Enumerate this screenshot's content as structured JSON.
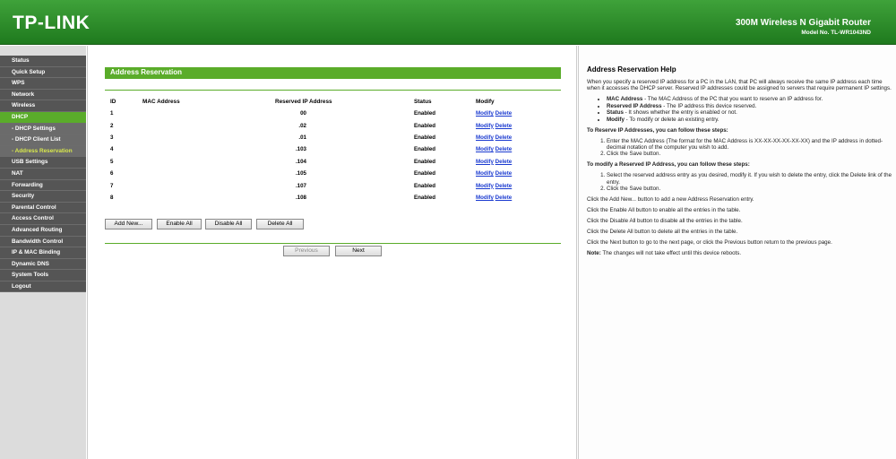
{
  "header": {
    "logo": "TP-LINK",
    "product_title": "300M Wireless N Gigabit Router",
    "product_model": "Model No. TL-WR1043ND"
  },
  "sidebar": {
    "items": [
      {
        "label": "Status"
      },
      {
        "label": "Quick Setup"
      },
      {
        "label": "WPS"
      },
      {
        "label": "Network"
      },
      {
        "label": "Wireless"
      },
      {
        "label": "DHCP"
      },
      {
        "label": "- DHCP Settings"
      },
      {
        "label": "- DHCP Client List"
      },
      {
        "label": "- Address Reservation"
      },
      {
        "label": "USB Settings"
      },
      {
        "label": "NAT"
      },
      {
        "label": "Forwarding"
      },
      {
        "label": "Security"
      },
      {
        "label": "Parental Control"
      },
      {
        "label": "Access Control"
      },
      {
        "label": "Advanced Routing"
      },
      {
        "label": "Bandwidth Control"
      },
      {
        "label": "IP & MAC Binding"
      },
      {
        "label": "Dynamic DNS"
      },
      {
        "label": "System Tools"
      },
      {
        "label": "Logout"
      }
    ]
  },
  "main": {
    "section_title": "Address Reservation",
    "table": {
      "headers": [
        "ID",
        "MAC Address",
        "Reserved IP Address",
        "Status",
        "Modify"
      ],
      "rows": [
        {
          "id": "1",
          "ip": "00",
          "status": "Enabled"
        },
        {
          "id": "2",
          "ip": ".02",
          "status": "Enabled"
        },
        {
          "id": "3",
          "ip": ".01",
          "status": "Enabled"
        },
        {
          "id": "4",
          "ip": ".103",
          "status": "Enabled"
        },
        {
          "id": "5",
          "ip": ".104",
          "status": "Enabled"
        },
        {
          "id": "6",
          "ip": ".105",
          "status": "Enabled"
        },
        {
          "id": "7",
          "ip": ".107",
          "status": "Enabled"
        },
        {
          "id": "8",
          "ip": ".108",
          "status": "Enabled"
        }
      ],
      "modify_label": "Modify",
      "delete_label": "Delete"
    },
    "buttons": {
      "add_new": "Add New...",
      "enable_all": "Enable All",
      "disable_all": "Disable All",
      "delete_all": "Delete All",
      "previous": "Previous",
      "next": "Next"
    }
  },
  "help": {
    "title": "Address Reservation Help",
    "intro": "When you specify a reserved IP address for a PC in the LAN, that PC will always receive the same IP address each time when it accesses the DHCP server. Reserved IP addresses could be assigned to servers that require permanent IP settings.",
    "bullets": [
      {
        "label": "MAC Address",
        "text": " - The MAC Address of the PC that you want to reserve an IP address for."
      },
      {
        "label": "Reserved IP Address",
        "text": " - The IP address this device reserved."
      },
      {
        "label": "Status",
        "text": " - It shows whether the entry is enabled or not."
      },
      {
        "label": "Modify",
        "text": " - To modify or delete an existing entry."
      }
    ],
    "reserve_heading": "To Reserve IP Addresses, you can follow these steps:",
    "reserve_steps": [
      "Enter the MAC Address (The format for the MAC Address is XX-XX-XX-XX-XX-XX) and the IP address in dotted-decimal notation of the computer you wish to add.",
      "Click the Save button."
    ],
    "modify_heading": "To modify a Reserved IP Address, you can follow these steps:",
    "modify_steps": [
      "Select the reserved address entry as you desired, modify it. If you wish to delete the entry, click the Delete link of the entry.",
      "Click the Save button."
    ],
    "notes": [
      "Click the Add New... button to add a new Address Reservation entry.",
      "Click the Enable All button to enable all the entries in the table.",
      "Click the Disable All button to disable all the entries in the table.",
      "Click the Delete All button to delete all the entries in the table.",
      "Click the Next button to go to the next page, or click the Previous button return to the previous page."
    ],
    "note_label": "Note:",
    "note_text": " The changes will not take effect until this device reboots."
  }
}
